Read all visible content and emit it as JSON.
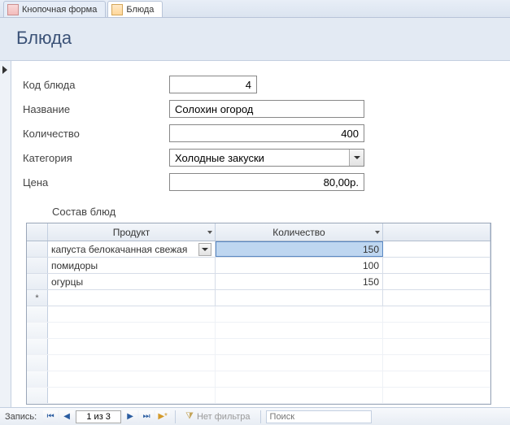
{
  "tabs": [
    {
      "label": "Кнопочная форма"
    },
    {
      "label": "Блюда"
    }
  ],
  "heading": "Блюда",
  "fields": {
    "code": {
      "label": "Код блюда",
      "value": "4"
    },
    "name": {
      "label": "Название",
      "value": "Солохин огород"
    },
    "qty": {
      "label": "Количество",
      "value": "400"
    },
    "category": {
      "label": "Категория",
      "value": "Холодные закуски"
    },
    "price": {
      "label": "Цена",
      "value": "80,00р."
    }
  },
  "subform": {
    "title": "Состав блюд",
    "columns": {
      "product": "Продукт",
      "qty": "Количество"
    },
    "rows": [
      {
        "product": "капуста белокачанная свежая",
        "qty": "150"
      },
      {
        "product": "помидоры",
        "qty": "100"
      },
      {
        "product": "огурцы",
        "qty": "150"
      }
    ],
    "new_marker": "*"
  },
  "nav": {
    "label": "Запись:",
    "position": "1 из 3",
    "filter": "Нет фильтра",
    "search_placeholder": "Поиск"
  }
}
